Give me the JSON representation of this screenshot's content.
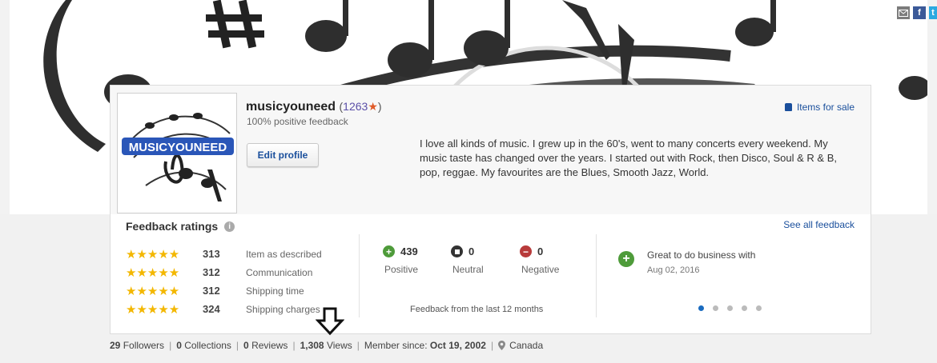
{
  "social": {
    "mail_icon": "mail-icon",
    "facebook_label": "f",
    "twitter_label": "t"
  },
  "profile": {
    "username": "musicyouneed",
    "score_open": "(",
    "score": "1263",
    "score_star": "★",
    "score_close": ")",
    "positive_feedback": "100% positive feedback",
    "edit_button": "Edit profile",
    "items_for_sale": "Items for sale",
    "bio": "I love all kinds of music. I grew up in the 60's, went to many concerts every weekend. My music taste has changed over the years. I started out with Rock, then Disco, Soul & R & B, pop, reggae. My favourites are the Blues, Smooth Jazz, World.",
    "avatar_logo_text": "MUSICYOUNEED"
  },
  "feedback": {
    "title": "Feedback ratings",
    "info_glyph": "i",
    "see_all": "See all feedback",
    "ratings": [
      {
        "stars": "★★★★★",
        "count": "313",
        "label": "Item as described",
        "rating": 5
      },
      {
        "stars": "★★★★★",
        "count": "312",
        "label": "Communication",
        "rating": 5
      },
      {
        "stars": "★★★★★",
        "count": "312",
        "label": "Shipping time",
        "rating": 5
      },
      {
        "stars": "★★★★★",
        "count": "324",
        "label": "Shipping charges",
        "rating": 5
      }
    ],
    "positive": {
      "count": "439",
      "label": "Positive",
      "glyph": "+"
    },
    "neutral": {
      "count": "0",
      "label": "Neutral"
    },
    "negative": {
      "count": "0",
      "label": "Negative",
      "glyph": "−"
    },
    "last12": "Feedback from the last 12 months",
    "comment": {
      "text": "Great to do business with",
      "date": "Aug 02, 2016",
      "glyph": "+"
    },
    "carousel_pages": 5,
    "carousel_active": 1
  },
  "footer": {
    "followers_count": "29",
    "followers_label": "Followers",
    "collections_count": "0",
    "collections_label": "Collections",
    "reviews_count": "0",
    "reviews_label": "Reviews",
    "views_count": "1,308",
    "views_label": "Views",
    "member_since_label": "Member since:",
    "member_since_date": "Oct 19, 2002",
    "location": "Canada"
  },
  "colors": {
    "link": "#1a4f9c",
    "star": "#f3b700",
    "positive": "#4e9b3a",
    "negative": "#b83b3b",
    "carousel_active": "#1a6bbf"
  }
}
